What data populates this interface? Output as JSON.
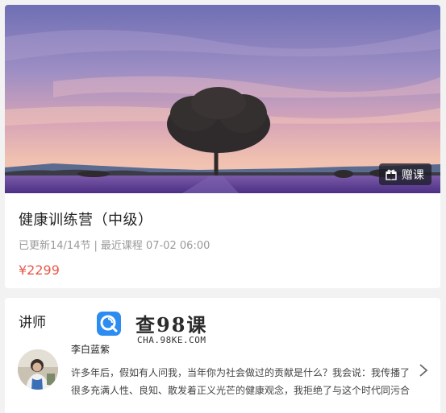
{
  "course": {
    "cover_alt": "lavender-field-tree-cover",
    "gift_label": "赠课",
    "title": "健康训练营（中级）",
    "updated": "已更新14/14节",
    "separator": "|",
    "latest": "最近课程 07-02 06:00",
    "price": "¥2299"
  },
  "teacher_section": {
    "heading": "讲师",
    "watermark": {
      "brand": "查98课",
      "url": "CHA.98KE.COM"
    },
    "teacher": {
      "name": "李白蓝紫",
      "bio_line1": "许多年后，假如有人问我，当年你为社会做过的贡献是什么？我会说：我传播了",
      "bio_line2": "很多充满人性、良知、散发着正义光芒的健康观念，我拒绝了与这个时代同污合"
    }
  },
  "icons": {
    "gift": "gift-icon",
    "chevron": "chevron-right-icon",
    "logo": "search-logo-icon"
  },
  "colors": {
    "price": "#e8594a",
    "meta": "#9a9a9a",
    "logo": "#2d8cf0"
  }
}
